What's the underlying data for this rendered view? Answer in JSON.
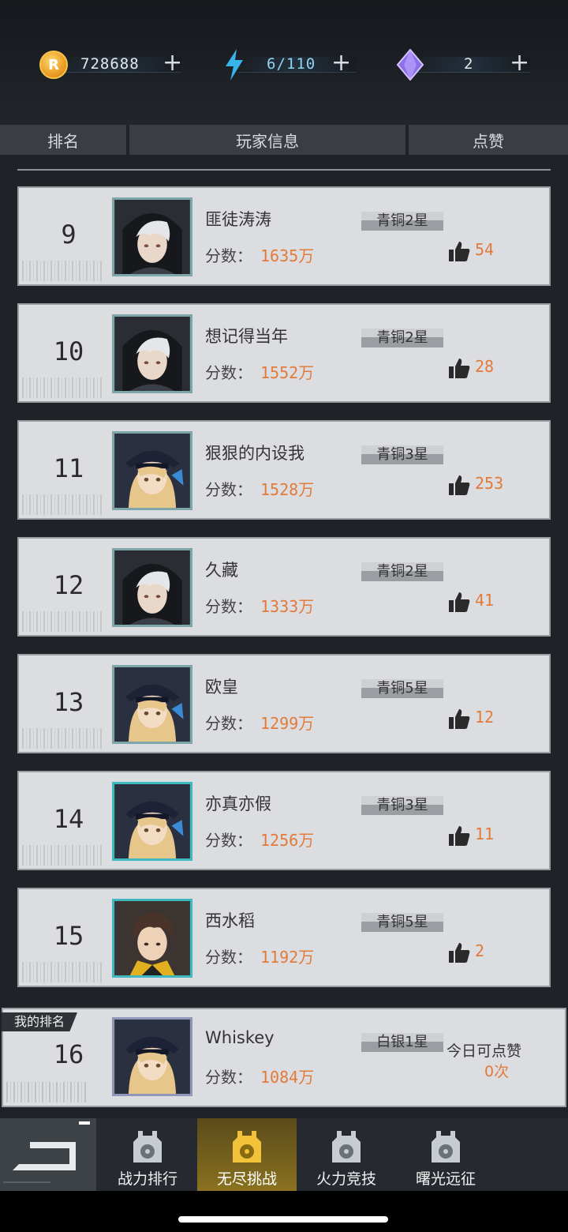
{
  "currency": {
    "coins": "728688",
    "energy": "6/110",
    "gems": "2",
    "coin_symbol": "R",
    "plus": "+"
  },
  "columns": [
    "排名",
    "玩家信息",
    "点赞"
  ],
  "score_label": "分数：",
  "rows": [
    {
      "rank": "9",
      "name": "匪徒涛涛",
      "score": "1635万",
      "tier": "青铜2星",
      "likes": "54",
      "avatar": "hooded"
    },
    {
      "rank": "10",
      "name": "想记得当年",
      "score": "1552万",
      "tier": "青铜2星",
      "likes": "28",
      "avatar": "hooded"
    },
    {
      "rank": "11",
      "name": "狠狠的内设我",
      "score": "1528万",
      "tier": "青铜3星",
      "likes": "253",
      "avatar": "officer"
    },
    {
      "rank": "12",
      "name": "久藏",
      "score": "1333万",
      "tier": "青铜2星",
      "likes": "41",
      "avatar": "hooded"
    },
    {
      "rank": "13",
      "name": "欧皇",
      "score": "1299万",
      "tier": "青铜5星",
      "likes": "12",
      "avatar": "officer"
    },
    {
      "rank": "14",
      "name": "亦真亦假",
      "score": "1256万",
      "tier": "青铜3星",
      "likes": "11",
      "avatar": "officer"
    },
    {
      "rank": "15",
      "name": "西水稻",
      "score": "1192万",
      "tier": "青铜5星",
      "likes": "2",
      "avatar": "brown"
    }
  ],
  "my_rank": {
    "tag": "我的排名",
    "rank": "16",
    "name": "Whiskey",
    "score": "1084万",
    "tier": "白银1星",
    "today_label": "今日可点赞",
    "today_count": "0次"
  },
  "nav": {
    "tabs": [
      {
        "label": "战力排行",
        "active": false
      },
      {
        "label": "无尽挑战",
        "active": true
      },
      {
        "label": "火力竞技",
        "active": false
      },
      {
        "label": "曙光远征",
        "active": false
      }
    ]
  },
  "colors": {
    "accent": "#e27a3a",
    "active_tab": "#8a7220",
    "row_bg": "#dcdde0"
  }
}
